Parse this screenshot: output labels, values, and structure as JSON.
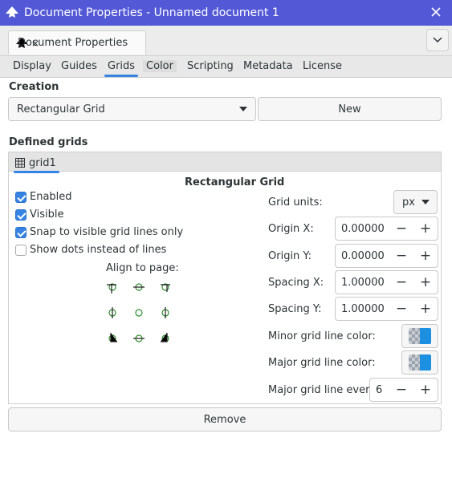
{
  "window": {
    "title": "Document Properties - Unnamed document 1"
  },
  "dock": {
    "tab_label": "Document Properties",
    "tab_close": "×"
  },
  "tabs": [
    {
      "label": "Display"
    },
    {
      "label": "Guides"
    },
    {
      "label": "Grids"
    },
    {
      "label": "Color"
    },
    {
      "label": "Scripting"
    },
    {
      "label": "Metadata"
    },
    {
      "label": "License"
    }
  ],
  "active_tab": "Grids",
  "creation": {
    "section": "Creation",
    "grid_type": "Rectangular Grid",
    "new_label": "New"
  },
  "defined": {
    "section": "Defined grids",
    "grid_tab": "grid1",
    "panel_title": "Rectangular Grid",
    "checkboxes": [
      {
        "label": "Enabled",
        "checked": true
      },
      {
        "label": "Visible",
        "checked": true
      },
      {
        "label": "Snap to visible grid lines only",
        "checked": true
      },
      {
        "label": "Show dots instead of lines",
        "checked": false
      }
    ],
    "align_label": "Align to page:",
    "grid_units_label": "Grid units:",
    "grid_units_value": "px",
    "origin_x_label": "Origin X:",
    "origin_x_value": "0.00000",
    "origin_y_label": "Origin Y:",
    "origin_y_value": "0.00000",
    "spacing_x_label": "Spacing X:",
    "spacing_x_value": "1.00000",
    "spacing_y_label": "Spacing Y:",
    "spacing_y_value": "1.00000",
    "minor_color_label": "Minor grid line color:",
    "major_color_label": "Major grid line color:",
    "major_every_label": "Major grid line every:",
    "major_every_value": "6",
    "minus": "−",
    "plus": "+",
    "remove_label": "Remove"
  },
  "colors": {
    "titlebar": "#5359d6",
    "accent": "#3584e4",
    "grid_color": "#1c8fe0",
    "anchor_green": "#2e8b2e"
  }
}
